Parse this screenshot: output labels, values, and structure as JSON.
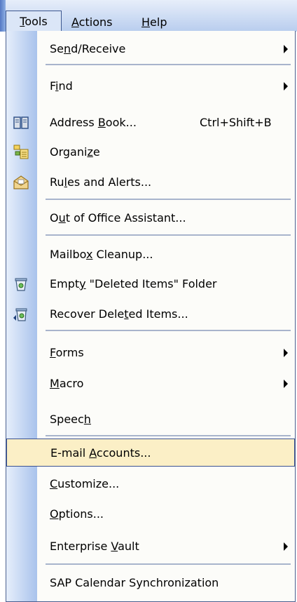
{
  "menubar": {
    "tools": {
      "mnemonic": "T",
      "rest": "ools"
    },
    "actions": {
      "mnemonic": "A",
      "rest": "ctions"
    },
    "help": {
      "mnemonic": "H",
      "rest": "elp"
    }
  },
  "menu": {
    "items": [
      {
        "pre": "Se",
        "mnemonic": "n",
        "post": "d/Receive",
        "submenu": true
      },
      {
        "pre": "F",
        "mnemonic": "i",
        "post": "nd",
        "submenu": true
      },
      {
        "pre": "Address ",
        "mnemonic": "B",
        "post": "ook...",
        "shortcut": "Ctrl+Shift+B",
        "icon": "address-book-icon"
      },
      {
        "pre": "Organi",
        "mnemonic": "z",
        "post": "e",
        "icon": "organize-icon"
      },
      {
        "pre": "Ru",
        "mnemonic": "l",
        "post": "es and Alerts...",
        "icon": "rules-alerts-icon"
      },
      {
        "pre": "O",
        "mnemonic": "u",
        "post": "t of Office Assistant..."
      },
      {
        "pre": "Mailbo",
        "mnemonic": "x",
        "post": " Cleanup..."
      },
      {
        "pre": "Empt",
        "mnemonic": "y",
        "post": " \"Deleted Items\" Folder",
        "icon": "empty-trash-icon"
      },
      {
        "pre": "Recover Dele",
        "mnemonic": "t",
        "post": "ed Items...",
        "icon": "recover-trash-icon"
      },
      {
        "pre": "",
        "mnemonic": "F",
        "post": "orms",
        "submenu": true
      },
      {
        "pre": "",
        "mnemonic": "M",
        "post": "acro",
        "submenu": true
      },
      {
        "pre": "Speec",
        "mnemonic": "h",
        "post": ""
      },
      {
        "pre": "E-mail ",
        "mnemonic": "A",
        "post": "ccounts...",
        "highlighted": true
      },
      {
        "pre": "",
        "mnemonic": "C",
        "post": "ustomize..."
      },
      {
        "pre": "",
        "mnemonic": "O",
        "post": "ptions..."
      },
      {
        "pre": "Enterprise ",
        "mnemonic": "V",
        "post": "ault",
        "submenu": true
      },
      {
        "pre": "SAP Calendar Synchronization",
        "mnemonic": "",
        "post": ""
      }
    ]
  },
  "colors": {
    "highlight_bg": "#fbefc6",
    "highlight_border": "#3b5290",
    "gutter_dark": "#a9c3ec"
  }
}
